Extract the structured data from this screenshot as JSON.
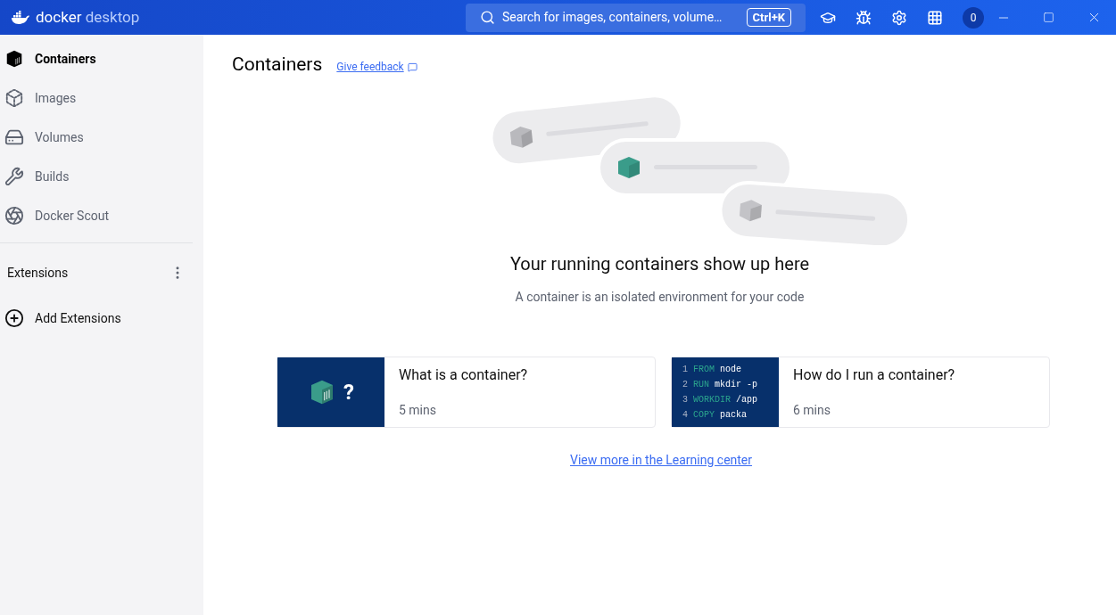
{
  "titlebar": {
    "logo_primary": "docker",
    "logo_secondary": "desktop",
    "search": {
      "placeholder": "Search for images, containers, volume…",
      "shortcut": "Ctrl+K"
    },
    "account_initial": "0"
  },
  "sidebar": {
    "items": [
      {
        "label": "Containers",
        "kind": "containers",
        "selected": true
      },
      {
        "label": "Images",
        "kind": "images",
        "selected": false
      },
      {
        "label": "Volumes",
        "kind": "volumes",
        "selected": false
      },
      {
        "label": "Builds",
        "kind": "builds",
        "selected": false
      },
      {
        "label": "Docker Scout",
        "kind": "scout",
        "selected": false
      }
    ],
    "extensions_label": "Extensions",
    "add_extensions": "Add Extensions"
  },
  "main": {
    "title": "Containers",
    "feedback_link": "Give feedback",
    "empty_title": "Your running containers show up here",
    "empty_subtitle": "A container is an isolated environment for your code",
    "cards": [
      {
        "kind": "icon",
        "symbol": "?",
        "title": "What is a container?",
        "duration": "5 mins"
      },
      {
        "kind": "code",
        "lines": [
          {
            "number": "1",
            "keyword": "FROM",
            "rest": "node"
          },
          {
            "number": "2",
            "keyword": "RUN",
            "rest": "mkdir -p"
          },
          {
            "number": "3",
            "keyword": "WORKDIR",
            "rest": "/app"
          },
          {
            "number": "4",
            "keyword": "COPY",
            "rest": "packa"
          }
        ],
        "title": "How do I run a container?",
        "duration": "6 mins"
      }
    ],
    "learning_link": "View more in the Learning center"
  }
}
